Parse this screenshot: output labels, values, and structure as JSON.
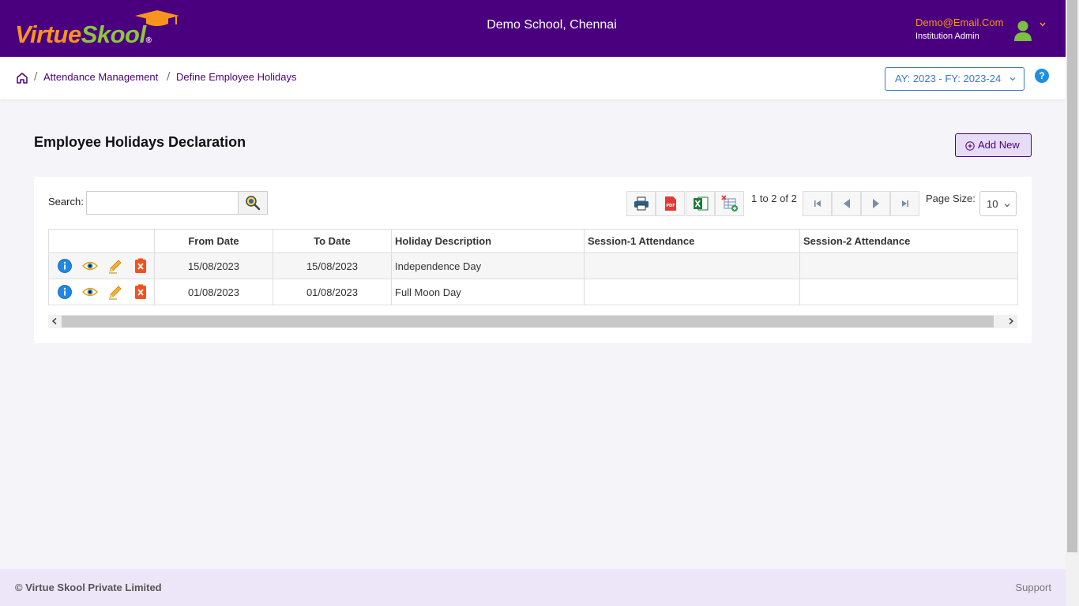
{
  "header": {
    "logo_text_1": "Virtue",
    "logo_text_2": "Skool",
    "logo_reg": "®",
    "school_name": "Demo School, Chennai",
    "user_email": "Demo@Email.Com",
    "user_role": "Institution Admin"
  },
  "breadcrumb": {
    "items": [
      "Attendance Management",
      "Define Employee Holidays"
    ],
    "separator": "/"
  },
  "ay_selector": {
    "value": "AY: 2023 - FY: 2023-24"
  },
  "help": {
    "label": "?"
  },
  "page": {
    "title": "Employee Holidays Declaration",
    "add_button": "Add New"
  },
  "search": {
    "label": "Search:",
    "value": "",
    "placeholder": ""
  },
  "toolbar": {
    "tools": [
      "printer-icon",
      "pdf-icon",
      "excel-icon",
      "column-chooser-icon"
    ]
  },
  "pagination": {
    "range": "1 to 2 of 2",
    "page_size_label": "Page Size:",
    "page_size": "10"
  },
  "table": {
    "columns": [
      "",
      "From Date",
      "To Date",
      "Holiday Description",
      "Session-1 Attendance",
      "Session-2 Attendance"
    ],
    "rows": [
      {
        "from": "15/08/2023",
        "to": "15/08/2023",
        "description": "Independence Day",
        "session1": "",
        "session2": ""
      },
      {
        "from": "01/08/2023",
        "to": "01/08/2023",
        "description": "Full Moon Day",
        "session1": "",
        "session2": ""
      }
    ],
    "row_actions": [
      "info-icon",
      "view-icon",
      "edit-icon",
      "delete-icon"
    ]
  },
  "footer": {
    "copyright": "© Virtue Skool Private Limited",
    "support": "Support"
  },
  "colors": {
    "brand_purple": "#4a007e",
    "brand_orange": "#f7941d",
    "brand_green": "#8dc63f",
    "link_blue": "#3c78c8"
  }
}
